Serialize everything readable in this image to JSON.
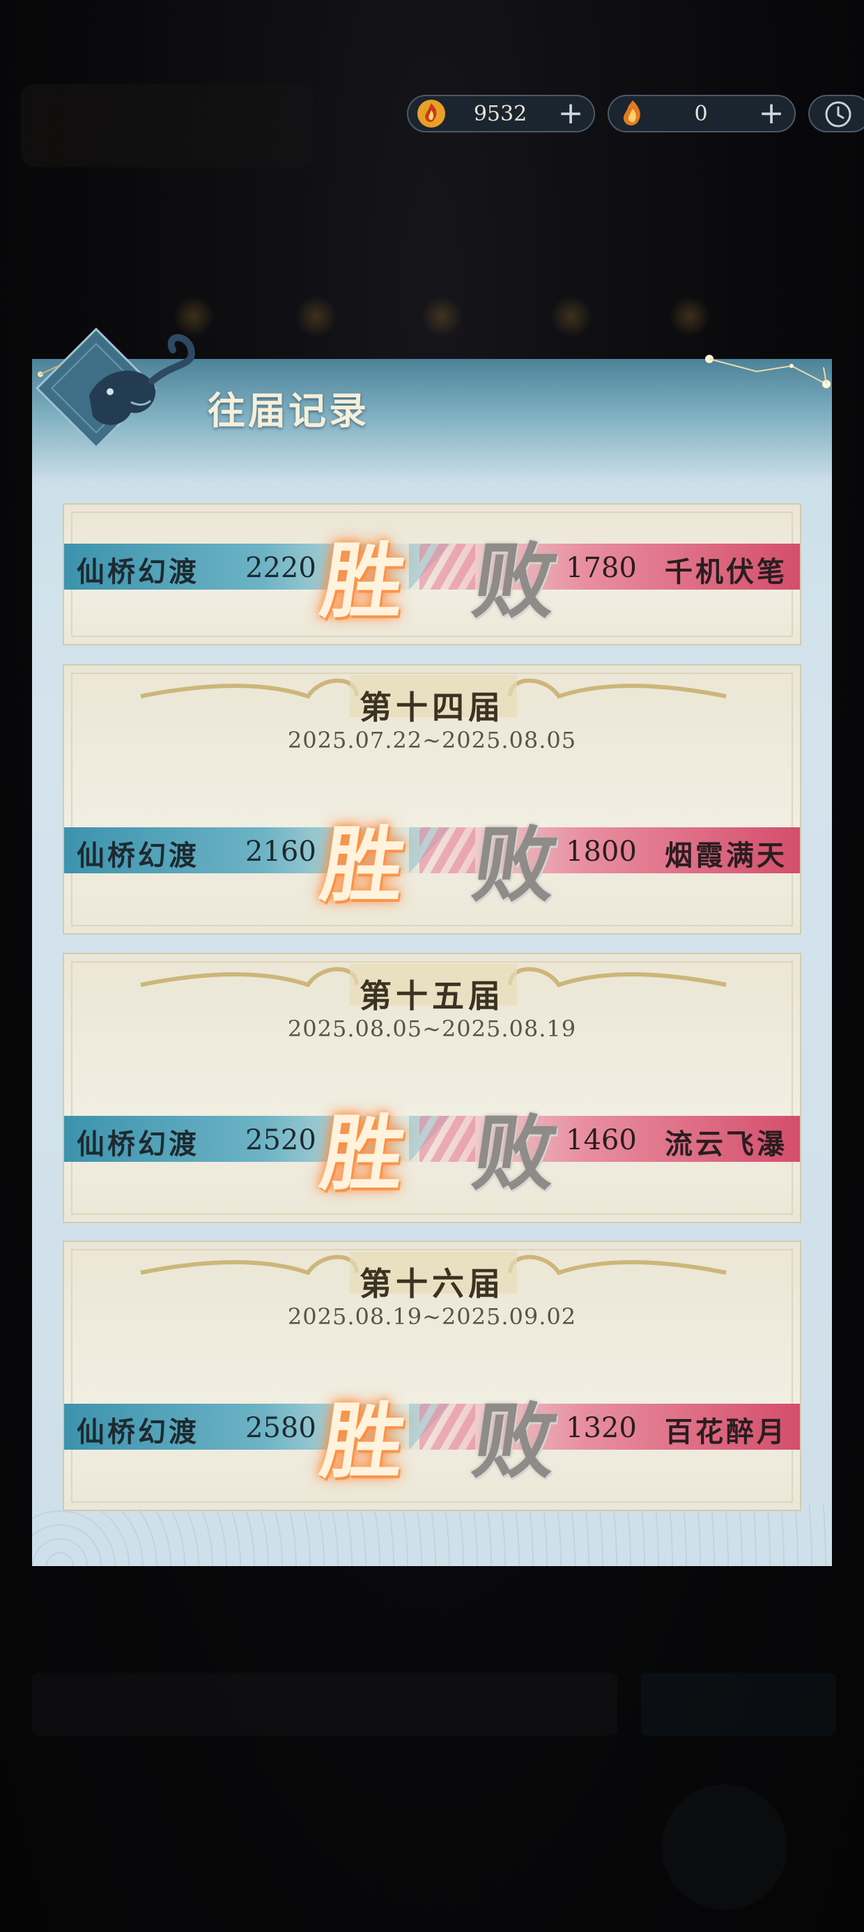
{
  "currencies": [
    {
      "icon": "flame-coin-icon",
      "value": "9532",
      "plus": "+"
    },
    {
      "icon": "flame-token-icon",
      "value": "0",
      "plus": "+"
    }
  ],
  "clock_icon": "clock-icon",
  "panel": {
    "title": "往届记录"
  },
  "records": [
    {
      "season": "",
      "date": "",
      "left_name": "仙桥幻渡",
      "left_score": "2220",
      "win": "胜",
      "lose": "败",
      "right_score": "1780",
      "right_name": "千机伏笔"
    },
    {
      "season": "第十四届",
      "date": "2025.07.22~2025.08.05",
      "left_name": "仙桥幻渡",
      "left_score": "2160",
      "win": "胜",
      "lose": "败",
      "right_score": "1800",
      "right_name": "烟霞满天"
    },
    {
      "season": "第十五届",
      "date": "2025.08.05~2025.08.19",
      "left_name": "仙桥幻渡",
      "left_score": "2520",
      "win": "胜",
      "lose": "败",
      "right_score": "1460",
      "right_name": "流云飞瀑"
    },
    {
      "season": "第十六届",
      "date": "2025.08.19~2025.09.02",
      "left_name": "仙桥幻渡",
      "left_score": "2580",
      "win": "胜",
      "lose": "败",
      "right_score": "1320",
      "right_name": "百花醉月"
    }
  ],
  "colors": {
    "left_band": "#3c93ad",
    "right_band": "#d44e6a",
    "win_glow": "#ff7a2a",
    "panel_header": "#4d8298"
  }
}
